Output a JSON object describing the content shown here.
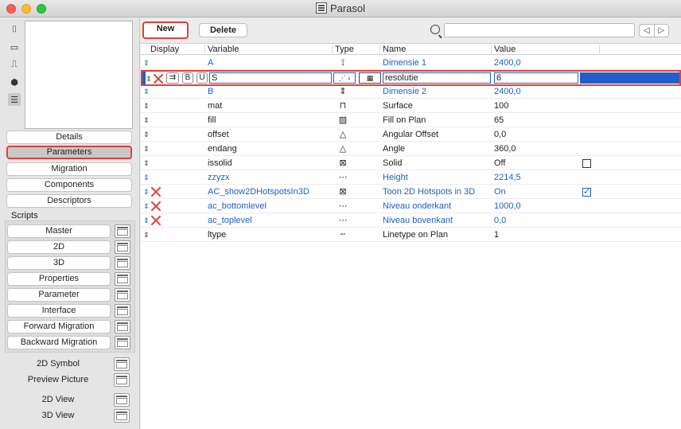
{
  "window": {
    "title": "Parasol"
  },
  "left": {
    "nav": [
      "Details",
      "Parameters",
      "Migration",
      "Components",
      "Descriptors"
    ],
    "selected_nav": "Parameters",
    "scripts_label": "Scripts",
    "scripts": [
      "Master",
      "2D",
      "3D",
      "Properties",
      "Parameter",
      "Interface",
      "Forward Migration",
      "Backward Migration"
    ],
    "extras": [
      "2D Symbol",
      "Preview Picture",
      "2D View",
      "3D View"
    ]
  },
  "toolbar": {
    "new_label": "New",
    "delete_label": "Delete",
    "search_placeholder": ""
  },
  "table": {
    "headers": {
      "display": "Display",
      "variable": "Variable",
      "type": "Type",
      "name": "Name",
      "value": "Value"
    },
    "rows": [
      {
        "variable": "A",
        "name": "Dimensie 1",
        "value": "2400,0",
        "blue": true,
        "type_icon": "⟟",
        "x": false
      },
      {
        "editing": true,
        "variable": "S",
        "name": "resolutie",
        "value": "6",
        "bold_label": "B",
        "unique_label": "U"
      },
      {
        "variable": "B",
        "name": "Dimensie 2",
        "value": "2400,0",
        "blue": true,
        "type_icon": "⇕",
        "x": false
      },
      {
        "variable": "mat",
        "name": "Surface",
        "value": "100",
        "blue": false,
        "type_icon": "⊓",
        "x": false
      },
      {
        "variable": "fill",
        "name": "Fill on Plan",
        "value": "65",
        "blue": false,
        "type_icon": "▨",
        "x": false
      },
      {
        "variable": "offset",
        "name": "Angular Offset",
        "value": "0,0",
        "blue": false,
        "type_icon": "△",
        "x": false
      },
      {
        "variable": "endang",
        "name": "Angle",
        "value": "360,0",
        "blue": false,
        "type_icon": "△",
        "x": false
      },
      {
        "variable": "issolid",
        "name": "Solid",
        "value": "Off",
        "blue": false,
        "type_icon": "⊠",
        "x": false,
        "checkbox": "off"
      },
      {
        "variable": "zzyzx",
        "name": "Height",
        "value": "2214,5",
        "blue": true,
        "type_icon": "⋯",
        "x": false
      },
      {
        "variable": "AC_show2DHotspotsIn3D",
        "name": "Toon 2D Hotspots in 3D",
        "value": "On",
        "blue": true,
        "type_icon": "⊠",
        "x": true,
        "checkbox": "on"
      },
      {
        "variable": "ac_bottomlevel",
        "name": "Niveau onderkant",
        "value": "1000,0",
        "blue": true,
        "type_icon": "⋯",
        "x": true
      },
      {
        "variable": "ac_toplevel",
        "name": "Niveau bovenkant",
        "value": "0,0",
        "blue": true,
        "type_icon": "⋯",
        "x": true
      },
      {
        "variable": "ltype",
        "name": "Linetype on Plan",
        "value": "1",
        "blue": false,
        "type_icon": "╌",
        "x": false
      }
    ]
  }
}
